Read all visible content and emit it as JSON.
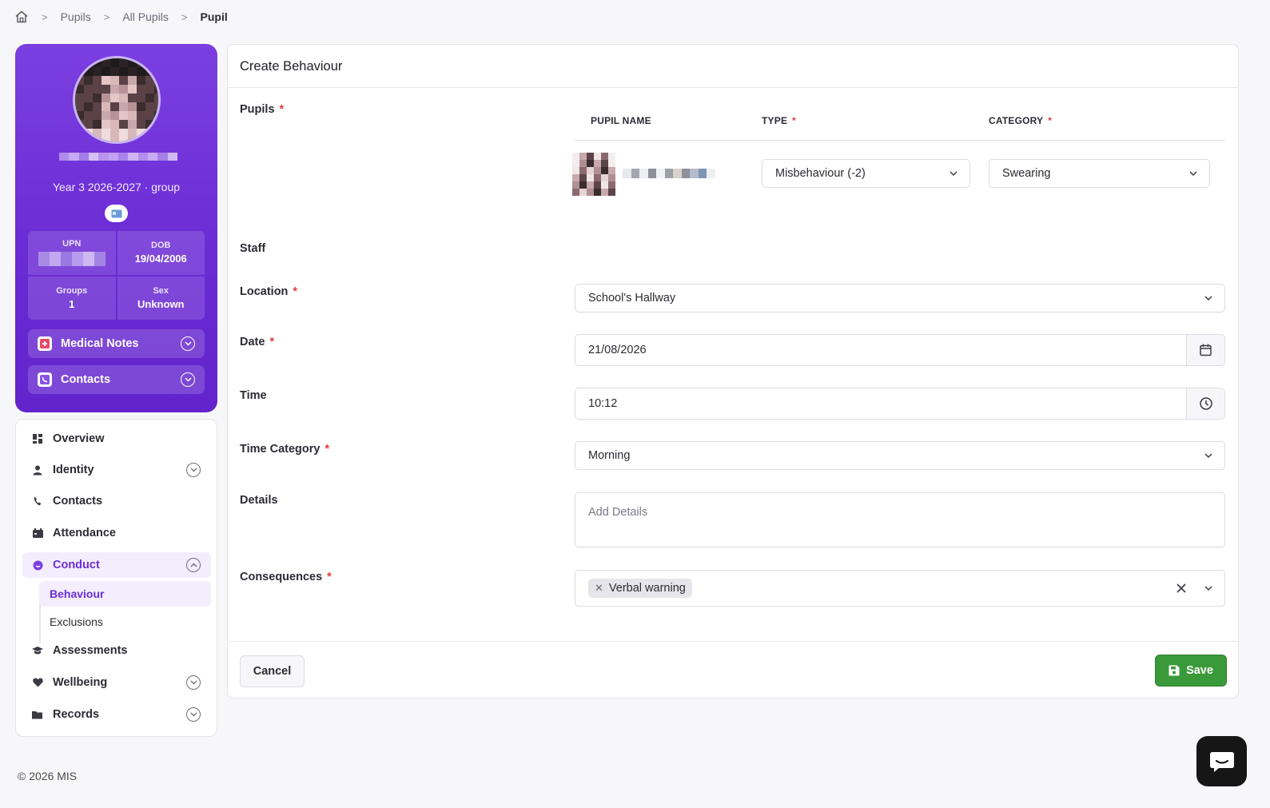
{
  "breadcrumb": {
    "items": [
      "Pupils",
      "All Pupils"
    ],
    "current": "Pupil"
  },
  "profile": {
    "group": "Year 3 2026-2027 · group",
    "stats": [
      {
        "label": "UPN",
        "value": ""
      },
      {
        "label": "DOB",
        "value": "19/04/2006"
      },
      {
        "label": "Groups",
        "value": "1"
      },
      {
        "label": "Sex",
        "value": "Unknown"
      }
    ],
    "accordions": [
      {
        "label": "Medical Notes",
        "icon": "medical-icon"
      },
      {
        "label": "Contacts",
        "icon": "phone-icon"
      }
    ]
  },
  "nav": {
    "items": [
      {
        "label": "Overview",
        "icon": "dashboard-icon"
      },
      {
        "label": "Identity",
        "icon": "user-icon"
      },
      {
        "label": "Contacts",
        "icon": "phone-icon"
      },
      {
        "label": "Attendance",
        "icon": "calendar-icon"
      },
      {
        "label": "Conduct",
        "icon": "conduct-icon"
      },
      {
        "label": "Assessments",
        "icon": "graduation-icon"
      },
      {
        "label": "Wellbeing",
        "icon": "heart-icon"
      },
      {
        "label": "Records",
        "icon": "folder-icon"
      }
    ],
    "conduct_sub": [
      "Behaviour",
      "Exclusions"
    ]
  },
  "form": {
    "title": "Create Behaviour",
    "labels": {
      "pupils": "Pupils",
      "staff": "Staff",
      "location": "Location",
      "date": "Date",
      "time": "Time",
      "time_category": "Time Category",
      "details": "Details",
      "consequences": "Consequences"
    },
    "required_mark": "*",
    "table_headers": {
      "pupil_name": "PUPIL NAME",
      "type": "TYPE",
      "category": "CATEGORY"
    },
    "pupil_row": {
      "type": "Misbehaviour (-2)",
      "category": "Swearing"
    },
    "location": "School's Hallway",
    "date": "21/08/2026",
    "time": "10:12",
    "time_category": "Morning",
    "details_placeholder": "Add Details",
    "consequences": [
      "Verbal warning"
    ],
    "cancel_label": "Cancel",
    "save_label": "Save"
  },
  "footer": "© 2026 MIS",
  "colors": {
    "accent": "#6b2fd6",
    "save": "#3a9a3a"
  }
}
